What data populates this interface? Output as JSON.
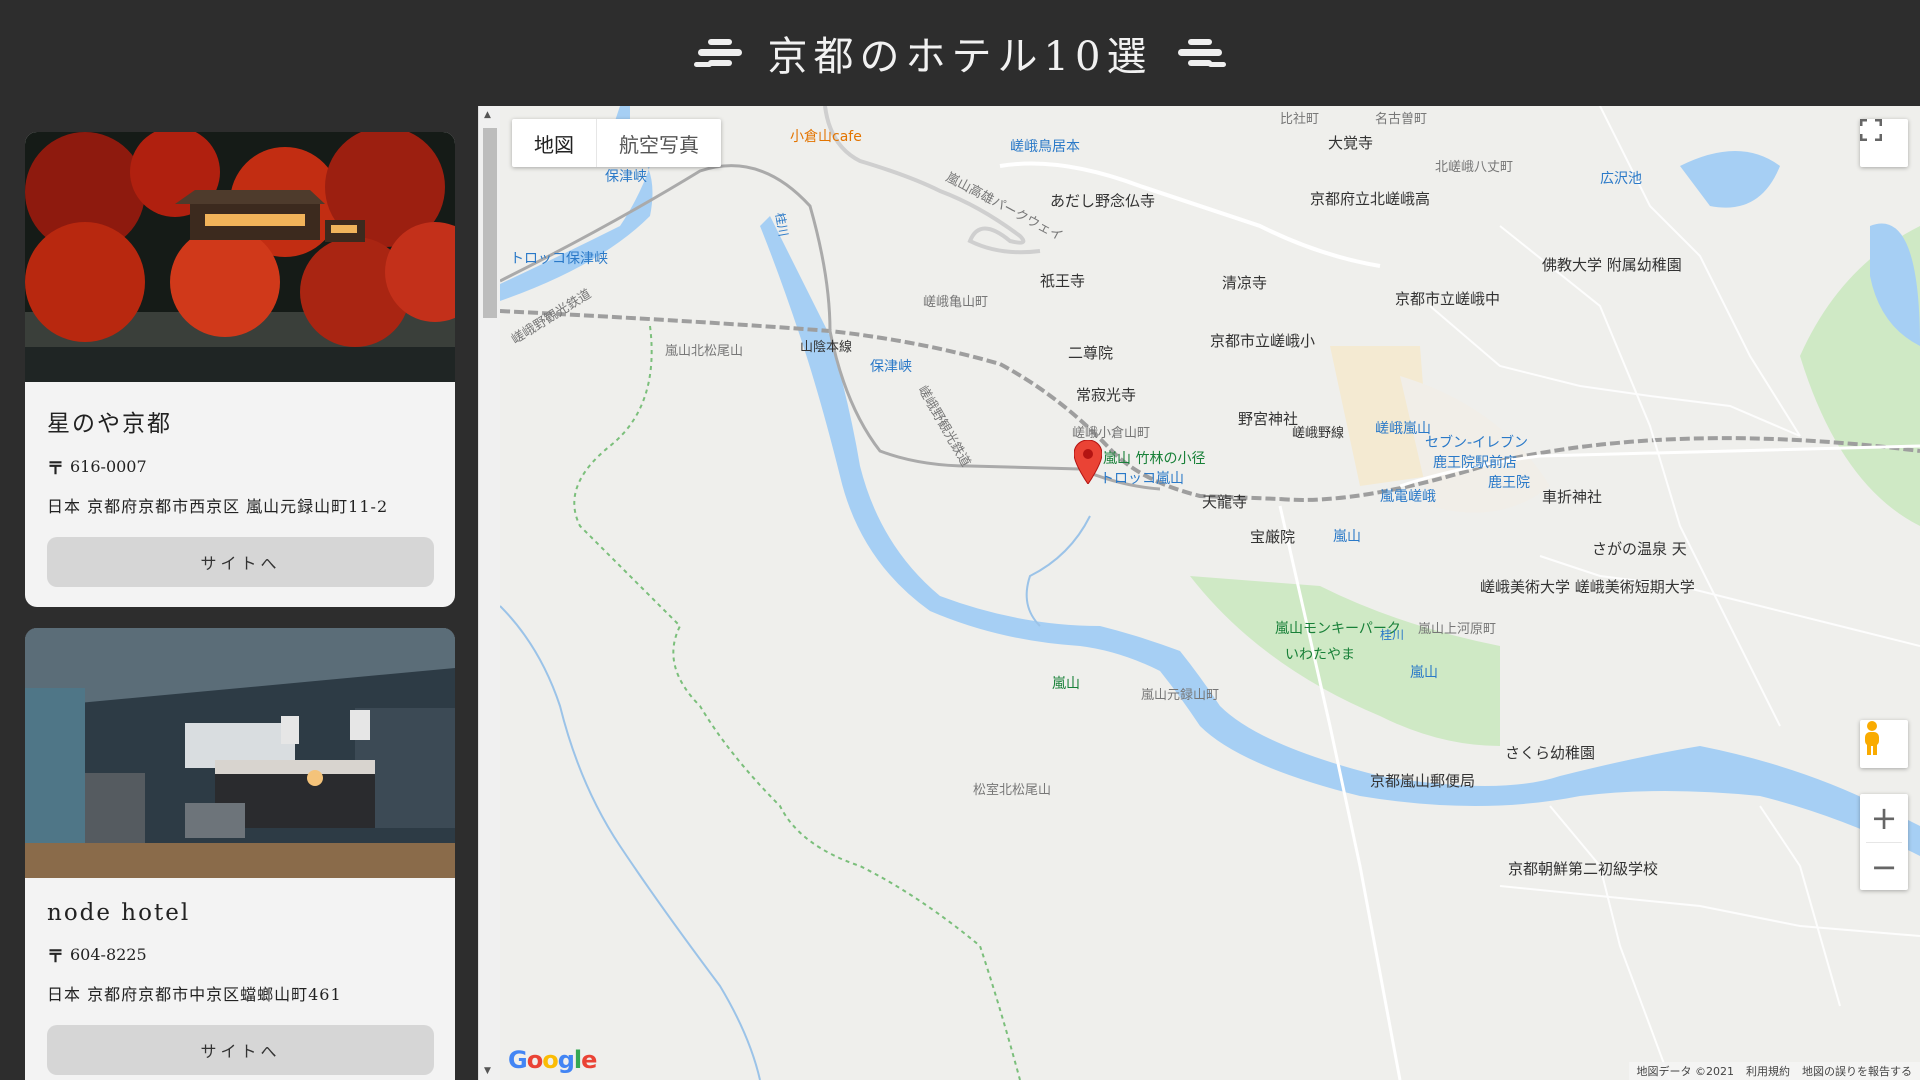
{
  "header": {
    "title": "京都のホテル10選"
  },
  "hotels": [
    {
      "name": "星のや京都",
      "zip_mark": "〒",
      "zip": "616-0007",
      "address": "日本 京都府京都市西京区 嵐山元録山町11-2",
      "button": "サイトへ"
    },
    {
      "name": "node hotel",
      "zip_mark": "〒",
      "zip": "604-8225",
      "address": "日本 京都府京都市中京区蟷螂山町461",
      "button": "サイトへ"
    }
  ],
  "map": {
    "map_type_tabs": [
      "地図",
      "航空写真"
    ],
    "labels": {
      "l01": "小倉山cafe",
      "l02": "嵯峨鳥居本",
      "l03": "嵐山高雄パークウェイ",
      "l04": "あだし野念仏寺",
      "l05": "保津峡",
      "l06": "トロッコ保津峡",
      "l07": "嵯峨野観光鉄道",
      "l08": "山陰本線",
      "l09": "保津峡",
      "l10": "嵯峨野観光鉄道",
      "l11": "嵐山北松尾山",
      "l12": "嵯峨亀山町",
      "l13": "祇王寺",
      "l14": "二尊院",
      "l15": "常寂光寺",
      "l16": "嵯峨小倉山町",
      "l17": "嵐山 竹林の小径",
      "l18": "トロッコ嵐山",
      "l19": "天龍寺",
      "l20": "宝厳院",
      "l21": "嵐山",
      "l22": "野宮神社",
      "l23": "嵯峨野線",
      "l24": "嵯峨嵐山",
      "l25": "セブン-イレブン",
      "l26": "鹿王院駅前店",
      "l27": "鹿王院",
      "l28": "嵐電嵯峨",
      "l29": "嵐山モンキーパーク",
      "l30": "いわたやま",
      "l31": "嵐山",
      "l32": "嵐山元録山町",
      "l33": "松室北松尾山",
      "l34": "嵐山",
      "l35": "さくら幼稚園",
      "l36": "京都嵐山郵便局",
      "l37": "京都府立北嵯峨高",
      "l38": "清凉寺",
      "l39": "京都市立嵯峨小",
      "l40": "京都市立嵯峨中",
      "l41": "大覚寺",
      "l42": "広沢池",
      "l43": "佛教大学 附属幼稚園",
      "l44": "車折神社",
      "l45": "さがの温泉 天",
      "l46": "嵯峨美術大学 嵯峨美術短期大学",
      "l47": "京都朝鮮第二初級学校",
      "l48": "嵐山上河原町",
      "l49": "比社町",
      "l50": "名古曽町",
      "l51": "北嵯峨八丈町",
      "l52": "桂川",
      "l53": "桂川"
    },
    "attribution": [
      "地図データ ©2021",
      "利用規約",
      "地図の誤りを報告する"
    ],
    "google": "Google",
    "zoom_in": "+",
    "zoom_out": "−"
  }
}
